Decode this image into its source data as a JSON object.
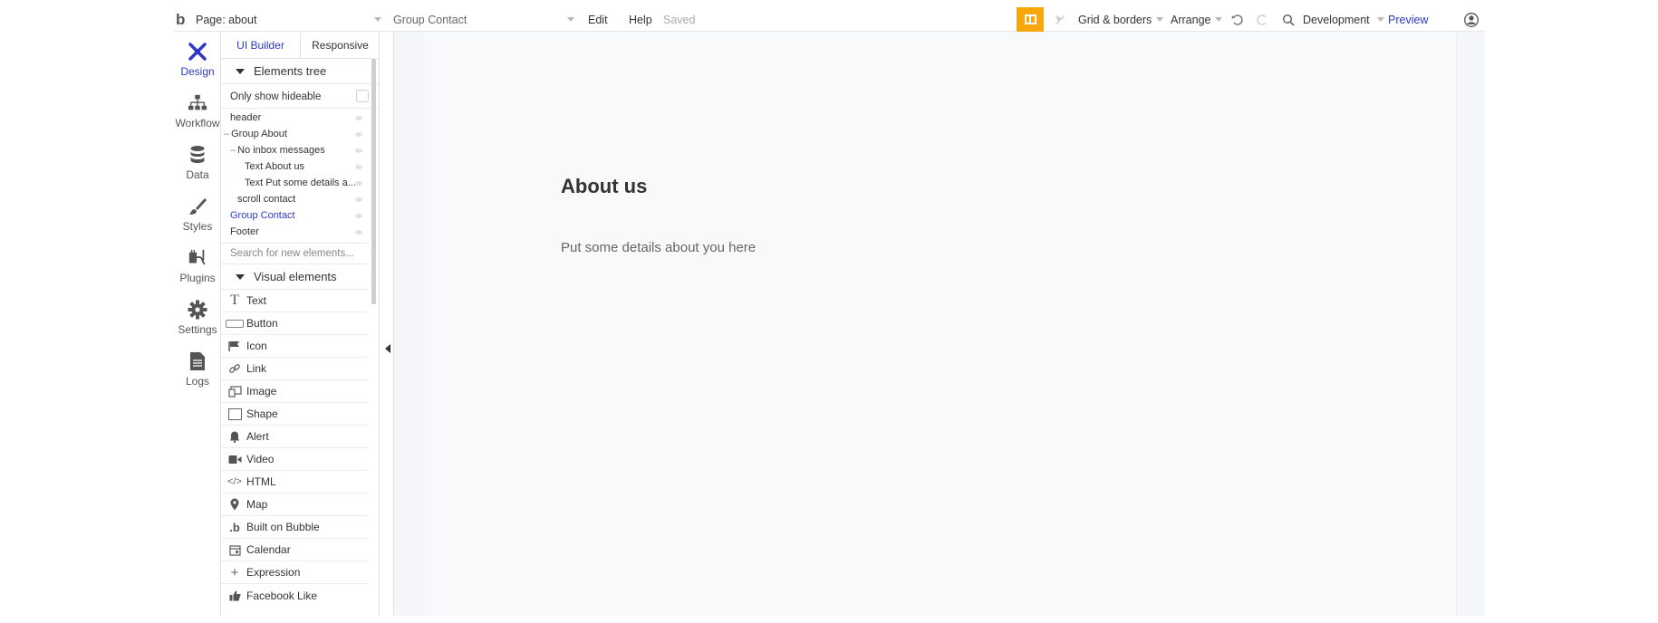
{
  "topbar": {
    "logo": "b",
    "page_label": "Page: about",
    "element_select": "Group Contact",
    "menu_edit": "Edit",
    "menu_help": "Help",
    "status": "Saved",
    "grid_borders": "Grid & borders",
    "arrange": "Arrange",
    "environment": "Development",
    "preview": "Preview",
    "accent_color": "#f5a70c",
    "link_color": "#2e39c9"
  },
  "rail": {
    "items": [
      {
        "label": "Design",
        "icon": "design-icon"
      },
      {
        "label": "Workflow",
        "icon": "workflow-icon"
      },
      {
        "label": "Data",
        "icon": "database-icon"
      },
      {
        "label": "Styles",
        "icon": "brush-icon"
      },
      {
        "label": "Plugins",
        "icon": "plug-icon"
      },
      {
        "label": "Settings",
        "icon": "gear-icon"
      },
      {
        "label": "Logs",
        "icon": "document-icon"
      }
    ]
  },
  "panel": {
    "tabs": [
      "UI Builder",
      "Responsive"
    ],
    "elements_tree_title": "Elements tree",
    "only_show_hideable": "Only show hideable",
    "tree": [
      {
        "label": "header"
      },
      {
        "label": "Group About"
      },
      {
        "label": "No inbox messages"
      },
      {
        "label": "Text About us"
      },
      {
        "label": "Text Put some details a..."
      },
      {
        "label": "scroll contact"
      },
      {
        "label": "Group Contact"
      },
      {
        "label": "Footer"
      }
    ],
    "search_placeholder": "Search for new elements...",
    "visual_elements_title": "Visual elements",
    "visual_elements": [
      {
        "label": "Text",
        "icon": "text-icon"
      },
      {
        "label": "Button",
        "icon": "button-icon"
      },
      {
        "label": "Icon",
        "icon": "flag-icon"
      },
      {
        "label": "Link",
        "icon": "link-icon"
      },
      {
        "label": "Image",
        "icon": "image-icon"
      },
      {
        "label": "Shape",
        "icon": "shape-icon"
      },
      {
        "label": "Alert",
        "icon": "bell-icon"
      },
      {
        "label": "Video",
        "icon": "video-icon"
      },
      {
        "label": "HTML",
        "icon": "code-icon"
      },
      {
        "label": "Map",
        "icon": "map-pin-icon"
      },
      {
        "label": "Built on Bubble",
        "icon": "bubble-logo-icon"
      },
      {
        "label": "Calendar",
        "icon": "calendar-icon"
      },
      {
        "label": "Expression",
        "icon": "plus-icon"
      },
      {
        "label": "Facebook Like",
        "icon": "thumbs-up-icon"
      }
    ]
  },
  "canvas": {
    "heading": "About us",
    "body": "Put some details about you here"
  }
}
